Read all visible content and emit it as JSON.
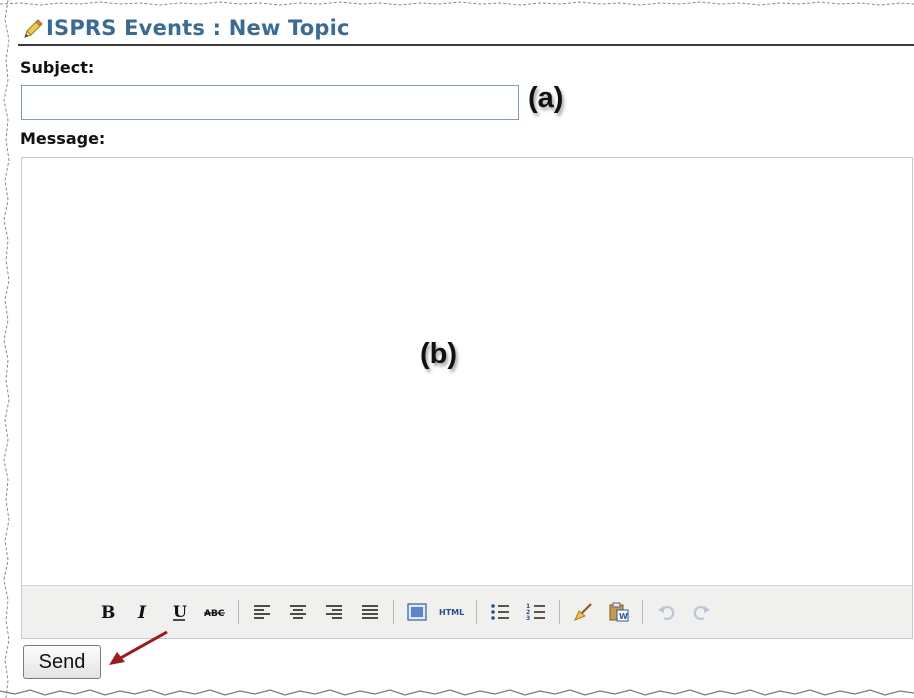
{
  "header": {
    "title": "ISPRS Events : New Topic",
    "icon": "pencil-icon"
  },
  "form": {
    "subject_label": "Subject:",
    "subject_value": "",
    "message_label": "Message:",
    "send_label": "Send"
  },
  "annotations": {
    "a": "(a)",
    "b": "(b)"
  },
  "toolbar": {
    "buttons": [
      "bold",
      "italic",
      "underline",
      "strikethrough",
      "align-left",
      "align-center",
      "align-right",
      "align-justify",
      "insert-image",
      "html-source",
      "bullet-list",
      "numbered-list",
      "cleanup",
      "paste-from-word",
      "undo",
      "redo"
    ],
    "html_label": "HTML"
  },
  "colors": {
    "title": "#3c6a93",
    "arrow": "#9b1c1c",
    "toolbar_bg": "#f0f0ee",
    "input_border": "#7f9db9"
  }
}
